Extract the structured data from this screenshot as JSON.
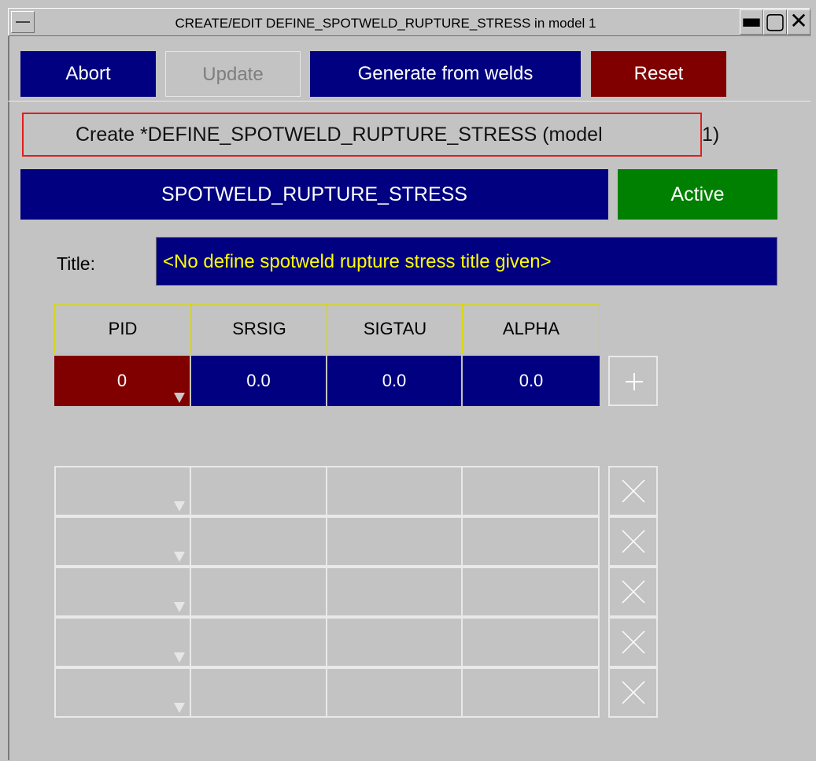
{
  "window": {
    "title": "CREATE/EDIT DEFINE_SPOTWELD_RUPTURE_STRESS in model 1",
    "controls": {
      "minimize": "▬",
      "maximize": "▢",
      "close": "✕"
    }
  },
  "toolbar": {
    "abort_label": "Abort",
    "update_label": "Update",
    "generate_label": "Generate from welds",
    "reset_label": "Reset"
  },
  "create_label": "Create *DEFINE_SPOTWELD_RUPTURE_STRESS (model",
  "create_label_suffix": "1)",
  "header": {
    "keyword": "SPOTWELD_RUPTURE_STRESS",
    "status": "Active"
  },
  "title_row": {
    "label": "Title:",
    "value": "<No define spotweld rupture stress title given>"
  },
  "table": {
    "columns": [
      "PID",
      "SRSIG",
      "SIGTAU",
      "ALPHA"
    ],
    "row": [
      "0",
      "0.0",
      "0.0",
      "0.0"
    ]
  },
  "colors": {
    "navy": "#000080",
    "maroon": "#800000",
    "green": "#008000",
    "title_text": "#ffff00",
    "background": "#c3c3c3"
  },
  "icons": {
    "add": "plus-icon",
    "delete": "x-icon",
    "dropdown": "dropdown-triangle-icon"
  }
}
